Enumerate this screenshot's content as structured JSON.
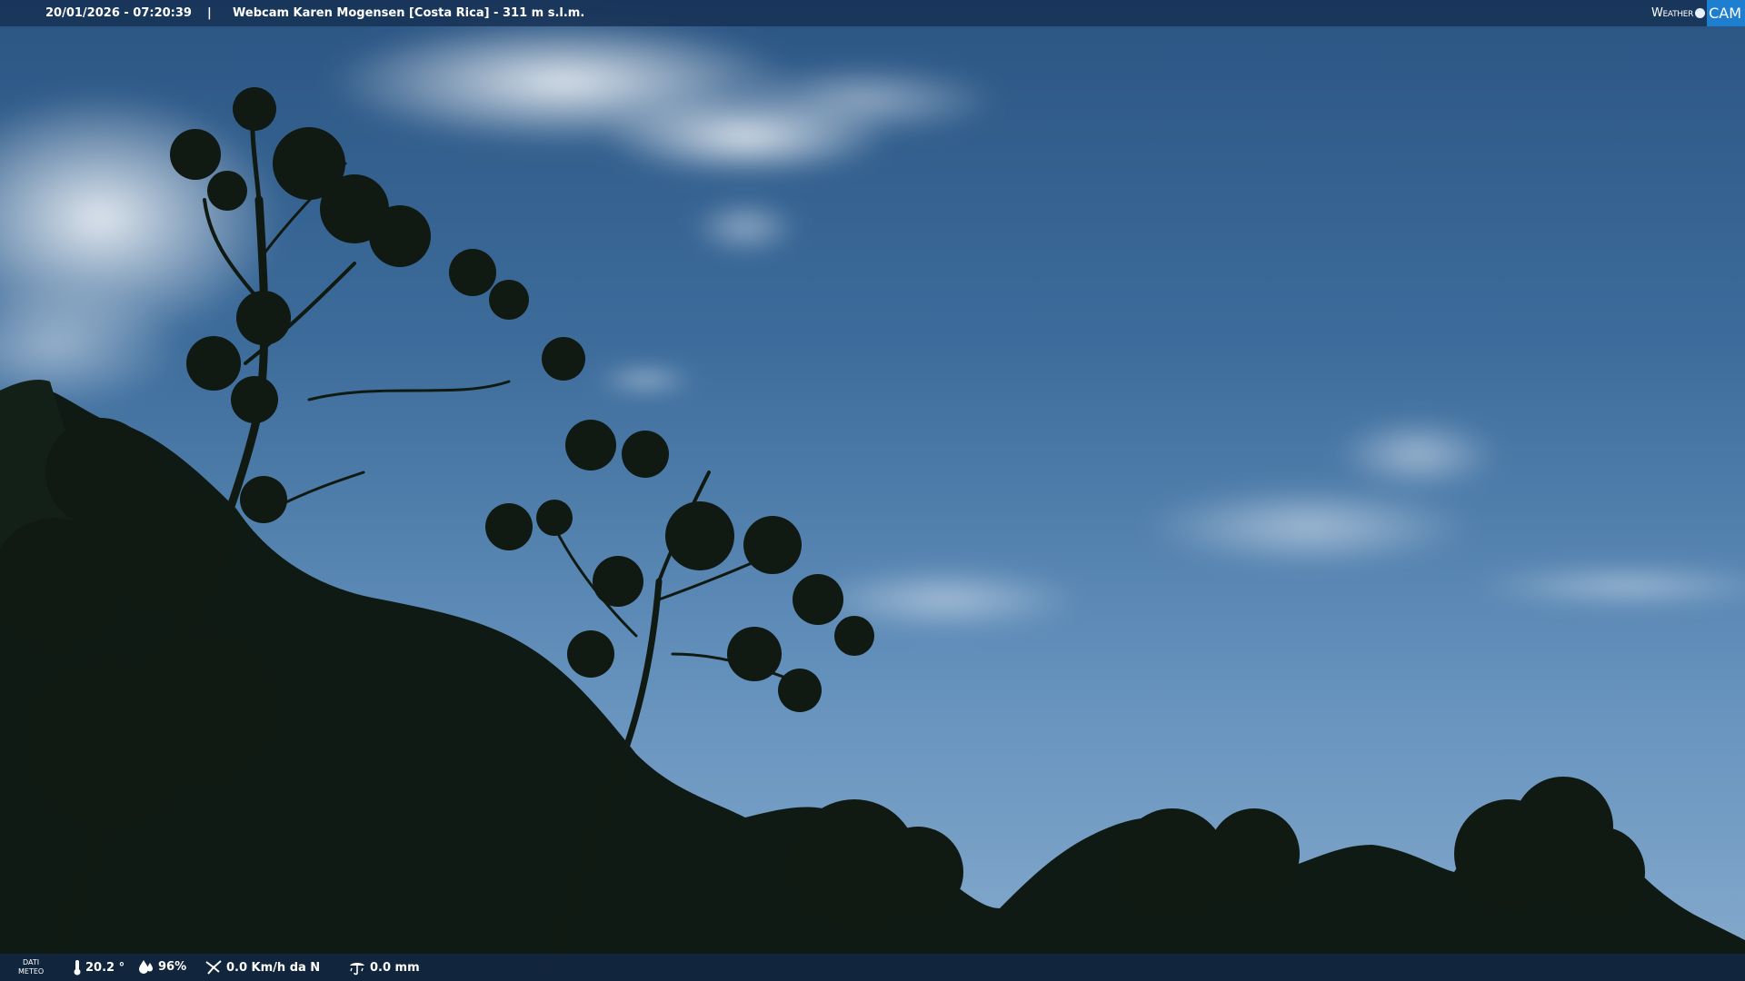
{
  "header": {
    "timestamp": "20/01/2026 - 07:20:39",
    "separator": "|",
    "title": "Webcam Karen Mogensen [Costa Rica] - 311 m s.l.m."
  },
  "brand": {
    "weather": "Weather",
    "cam": "CAM"
  },
  "meteo": {
    "label_line1": "DATI",
    "label_line2": "METEO",
    "temperature": "20.2 °",
    "humidity": "96%",
    "wind": "0.0 Km/h da N",
    "rain": "0.0 mm"
  },
  "icons": {
    "temperature": "thermometer-icon",
    "humidity": "humidity-drop-icon",
    "wind": "wind-icon",
    "rain": "rain-gauge-icon"
  },
  "colors": {
    "bar_bg": "#142d50",
    "brand_accent": "#1e7fd0",
    "text": "#ffffff"
  }
}
